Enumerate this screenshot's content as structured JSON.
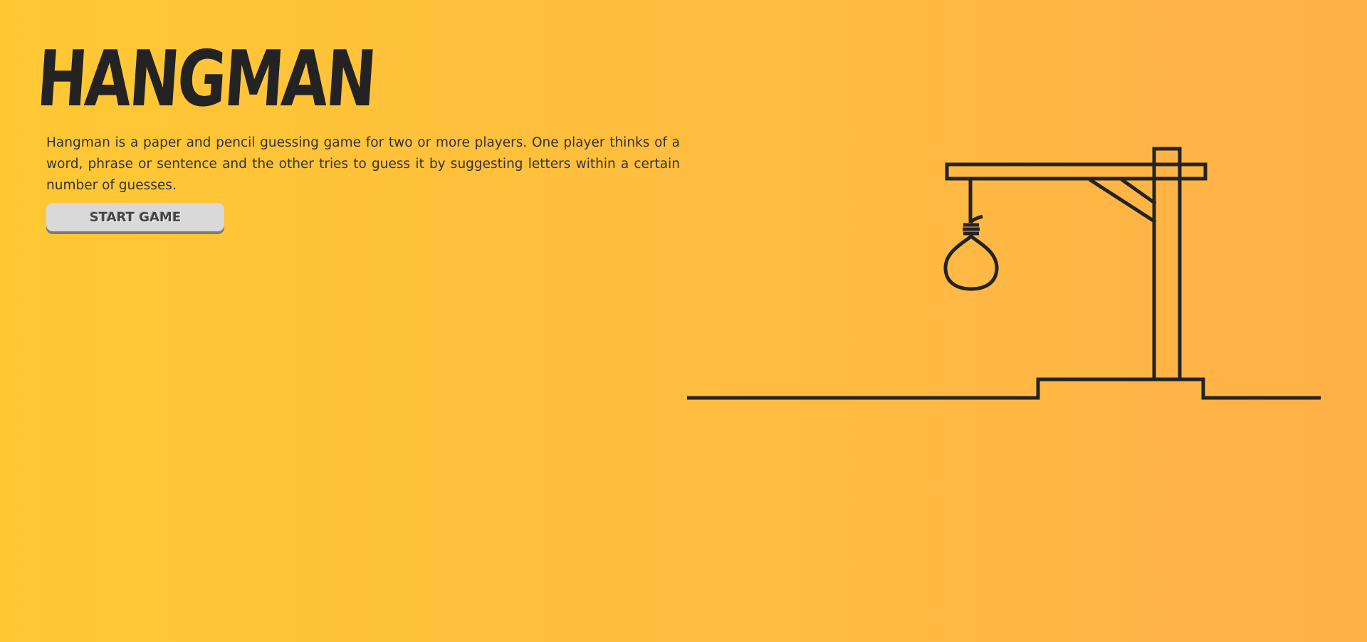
{
  "page": {
    "title": "HANGMAN",
    "description": "Hangman is a paper and pencil guessing game for two or more players. One player thinks of a word, phrase or sentence and the other tries to guess it by suggesting letters within a certain number of guesses.",
    "start_button_label": "START GAME"
  },
  "colors": {
    "background_start": "#ffc833",
    "background_end": "#ffb046",
    "ink": "#232323",
    "button": "#d9d9d9"
  },
  "illustration": {
    "name": "gallows-with-noose-icon"
  }
}
